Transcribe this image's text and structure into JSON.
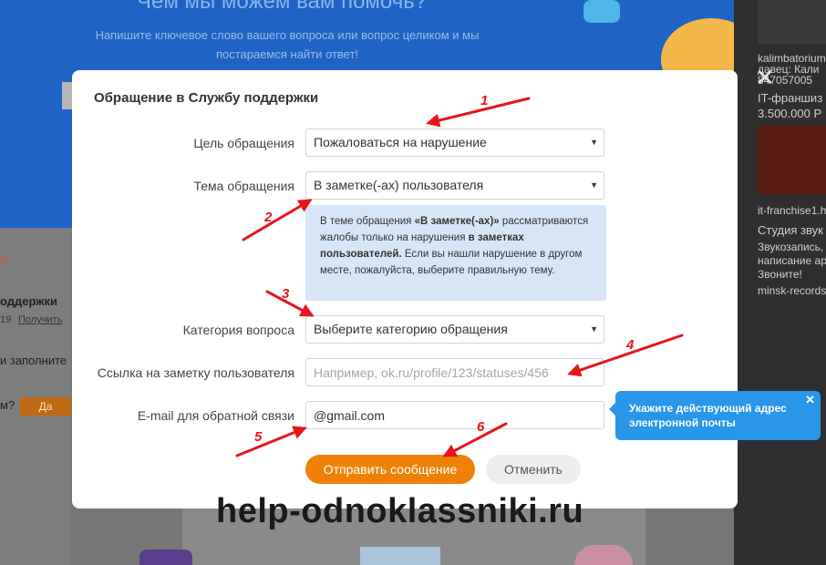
{
  "background": {
    "hero_title": "Чем мы можем вам помочь?",
    "hero_subtitle": "Напишите ключевое слово вашего вопроса или вопрос целиком и мы постараемся найти ответ!",
    "left_red": "ы",
    "left_heading": "оддержки",
    "left_meta_a": "19",
    "left_meta_b": "Получить",
    "left_text": "и заполните",
    "left_question": "м?",
    "left_button": "Да",
    "ad_domain_1": "kalimbatorium.",
    "ad_seller": "давец: Кали",
    "ad_phone": "847057005",
    "ad_title_1": "IT-франшиз",
    "ad_price_1": "3.500.000 Р",
    "ad_domain_2": "it-franchise1.h",
    "ad_title_2": "Студия звук",
    "ad_desc_2a": "Звукозапись,",
    "ad_desc_2b": "написание ар",
    "ad_desc_2c": "Звоните!",
    "ad_domain_3": "minsk-records.",
    "colors": {
      "hero": "#1f63c6",
      "overlay": "#767676"
    }
  },
  "modal": {
    "title": "Обращение в Службу поддержки",
    "fields": {
      "purpose": {
        "label": "Цель обращения",
        "value": "Пожаловаться на нарушение"
      },
      "topic": {
        "label": "Тема обращения",
        "value": "В заметке(-ах) пользователя"
      },
      "category": {
        "label": "Категория вопроса",
        "value": "Выберите категорию обращения"
      },
      "link": {
        "label": "Ссылка на заметку пользователя",
        "placeholder": "Например, ok.ru/profile/123/statuses/456",
        "value": ""
      },
      "email": {
        "label": "E-mail для обратной связи",
        "value": "@gmail.com"
      }
    },
    "info": {
      "p1": "В теме обращения ",
      "b1": "«В заметке(-ах)»",
      "p2": " рассматриваются жалобы только на нарушения ",
      "b2": "в заметках пользователей.",
      "p3": " Если вы нашли нарушение в другом месте, пожалуйста, выберите правильную тему."
    },
    "submit_label": "Отправить сообщение",
    "cancel_label": "Отменить",
    "close_glyph": "✕",
    "caret_glyph": "▼",
    "colors": {
      "primary": "#ee8208",
      "info_bg": "#d7e6f7"
    }
  },
  "tooltip": {
    "text": "Укажите действующий адрес электронной почты",
    "close_glyph": "✕",
    "color": "#2996ea"
  },
  "annotations": {
    "numbers": [
      "1",
      "2",
      "3",
      "4",
      "5",
      "6"
    ],
    "color": "#e8141c"
  },
  "watermark": "help-odnoklassniki.ru"
}
